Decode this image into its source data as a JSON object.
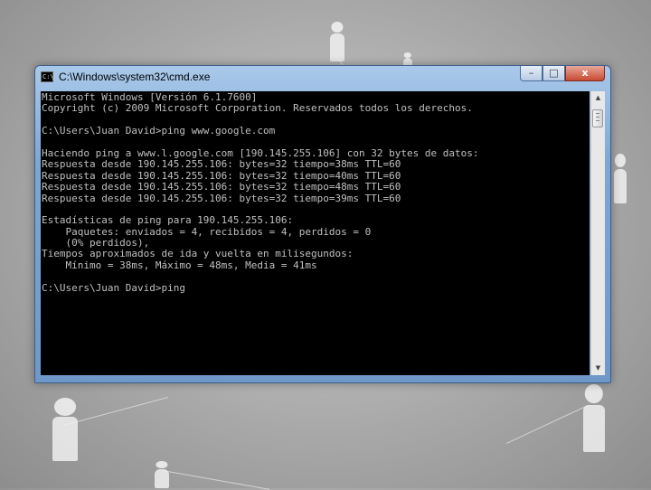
{
  "window": {
    "title": "C:\\Windows\\system32\\cmd.exe",
    "icon": "cmd-icon",
    "icon_glyph": "C:\\",
    "controls": {
      "minimize": "–",
      "maximize": "□",
      "close": "x"
    }
  },
  "console": {
    "lines": [
      "Microsoft Windows [Versión 6.1.7600]",
      "Copyright (c) 2009 Microsoft Corporation. Reservados todos los derechos.",
      "",
      "C:\\Users\\Juan David>ping www.google.com",
      "",
      "Haciendo ping a www.l.google.com [190.145.255.106] con 32 bytes de datos:",
      "Respuesta desde 190.145.255.106: bytes=32 tiempo=38ms TTL=60",
      "Respuesta desde 190.145.255.106: bytes=32 tiempo=40ms TTL=60",
      "Respuesta desde 190.145.255.106: bytes=32 tiempo=48ms TTL=60",
      "Respuesta desde 190.145.255.106: bytes=32 tiempo=39ms TTL=60",
      "",
      "Estadísticas de ping para 190.145.255.106:",
      "    Paquetes: enviados = 4, recibidos = 4, perdidos = 0",
      "    (0% perdidos),",
      "Tiempos aproximados de ida y vuelta en milisegundos:",
      "    Mínimo = 38ms, Máximo = 48ms, Media = 41ms",
      "",
      "C:\\Users\\Juan David>ping"
    ]
  },
  "scrollbar": {
    "up_arrow": "▲",
    "down_arrow": "▼"
  },
  "colors": {
    "console_bg": "#000000",
    "console_text": "#c0c0c0",
    "title_bar": "#8fb2dd",
    "close_button": "#c84a31"
  }
}
